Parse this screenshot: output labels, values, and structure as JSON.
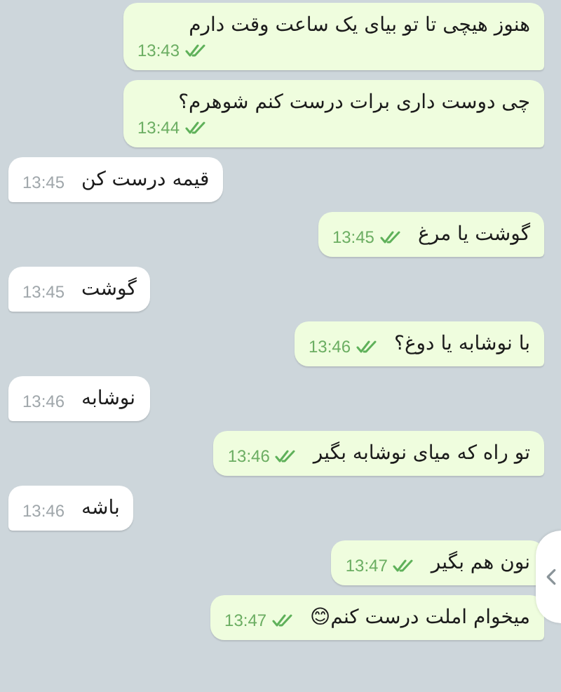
{
  "messages": [
    {
      "kind": "outgoing",
      "text": "هنوز هیچی تا تو بیای یک ساعت وقت دارم",
      "time": "13:43",
      "read": true
    },
    {
      "kind": "outgoing",
      "text": "چی دوست داری برات درست کنم شوهرم؟",
      "time": "13:44",
      "read": true
    },
    {
      "kind": "incoming",
      "text": "قیمه درست کن",
      "time": "13:45"
    },
    {
      "kind": "outgoing",
      "text": "گوشت یا مرغ",
      "time": "13:45",
      "read": true
    },
    {
      "kind": "incoming",
      "text": "گوشت",
      "time": "13:45"
    },
    {
      "kind": "outgoing",
      "text": "با نوشابه یا دوغ؟",
      "time": "13:46",
      "read": true
    },
    {
      "kind": "incoming",
      "text": "نوشابه",
      "time": "13:46"
    },
    {
      "kind": "outgoing",
      "text": "تو راه که میای نوشابه بگیر",
      "time": "13:46",
      "read": true
    },
    {
      "kind": "incoming",
      "text": "باشه",
      "time": "13:46"
    },
    {
      "kind": "outgoing",
      "text": "نون هم بگیر",
      "time": "13:47",
      "read": true
    },
    {
      "kind": "outgoing",
      "text": "میخوام املت درست کنم😊",
      "time": "13:47",
      "read": true
    }
  ]
}
